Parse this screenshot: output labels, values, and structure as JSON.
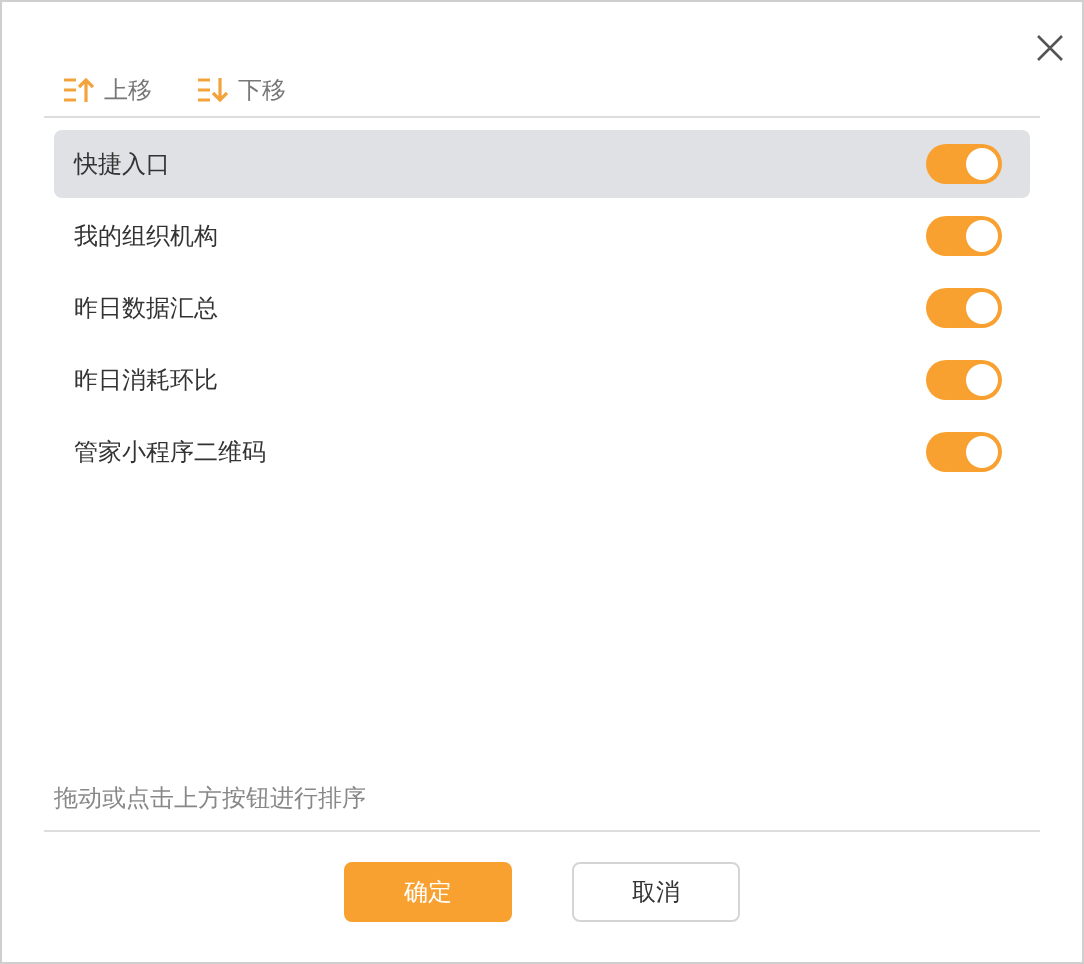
{
  "toolbar": [
    {
      "kind": "up",
      "label": "上移"
    },
    {
      "kind": "down",
      "label": "下移"
    }
  ],
  "items": [
    {
      "label": "快捷入口",
      "selected": true,
      "on": true
    },
    {
      "label": "我的组织机构",
      "selected": false,
      "on": true
    },
    {
      "label": "昨日数据汇总",
      "selected": false,
      "on": true
    },
    {
      "label": "昨日消耗环比",
      "selected": false,
      "on": true
    },
    {
      "label": "管家小程序二维码",
      "selected": false,
      "on": true
    }
  ],
  "hint": "拖动或点击上方按钮进行排序",
  "buttons": [
    {
      "kind": "primary",
      "label": "确定"
    },
    {
      "kind": "secondary",
      "label": "取消"
    }
  ]
}
